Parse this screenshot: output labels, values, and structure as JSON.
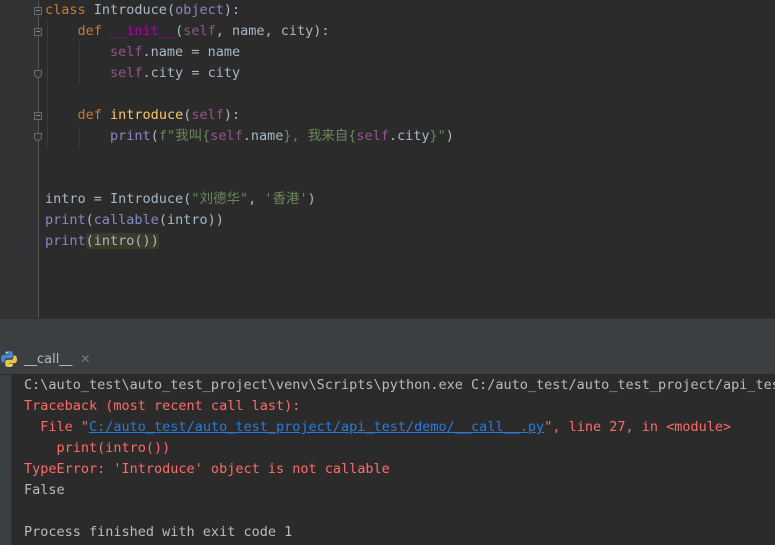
{
  "editor": {
    "lines": {
      "l1": {
        "kw_class": "class",
        "name": "Introduce",
        "p_open": "(",
        "base": "object",
        "p_close": "):"
      },
      "l2": {
        "kw_def": "def",
        "fname": "__init__",
        "p_open": "(",
        "self": "self",
        "args": ", name, city):"
      },
      "l3": {
        "self": "self",
        "rest": ".name = name"
      },
      "l4": {
        "self": "self",
        "rest": ".city = city"
      },
      "l6": {
        "kw_def": "def",
        "fname": "introduce",
        "p_open": "(",
        "self": "self",
        "p_close": "):"
      },
      "l7": {
        "print": "print",
        "p_open": "(",
        "f_prefix": "f\"我叫{",
        "self1": "self",
        "name_part": ".name",
        "mid": "}, 我来自{",
        "self2": "self",
        "city_part": ".city",
        "end_str": "}\"",
        "p_close": ")"
      },
      "l10": {
        "var": "intro = Introduce(",
        "s1": "\"刘德华\"",
        "comma": ", ",
        "s2": "'香港'",
        "close": ")"
      },
      "l11": {
        "print": "print",
        "p_open": "(",
        "callable": "callable",
        "rest": "(intro))"
      },
      "l12": {
        "print": "print",
        "p_open": "(",
        "hl_text": "intro()",
        "p_close": ")"
      }
    }
  },
  "run_panel": {
    "tab_label": "__call__",
    "close_glyph": "✕",
    "console": {
      "cmd": "C:\\auto_test\\auto_test_project\\venv\\Scripts\\python.exe C:/auto_test/auto_test_project/api_test",
      "traceback": "Traceback (most recent call last):",
      "file_prefix": "  File \"",
      "file_link": "C:/auto_test/auto_test_project/api_test/demo/__call__.py",
      "file_suffix": "\", line 27, in <module>",
      "code_line": "    print(intro())",
      "error": "TypeError: 'Introduce' object is not callable",
      "output": "False",
      "finished": "Process finished with exit code 1"
    }
  },
  "icons": {
    "tab_icon": "python-icon",
    "fold_icon": "fold-marker-icon"
  },
  "colors": {
    "keyword": "#cc7832",
    "builtin": "#8888c6",
    "string": "#6a8759",
    "function": "#ffc66d",
    "self": "#94558d",
    "error": "#ff6b68",
    "link": "#287bde"
  }
}
